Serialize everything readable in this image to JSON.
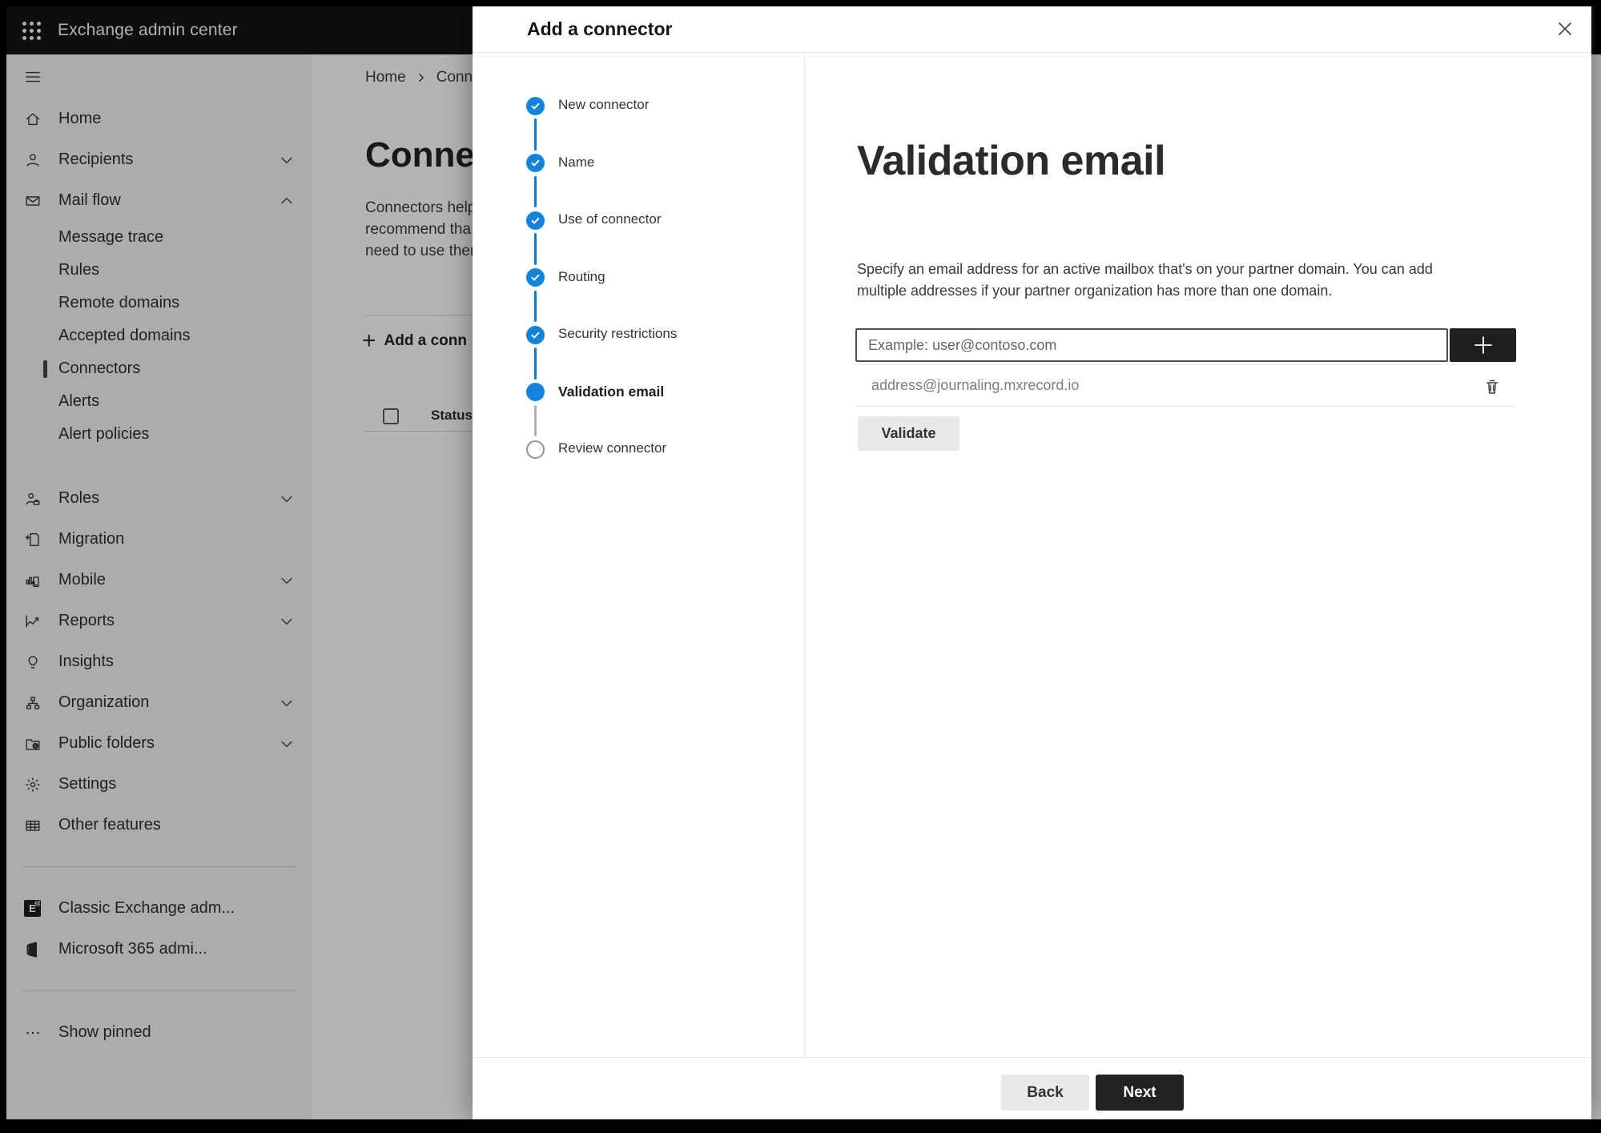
{
  "app_bar": {
    "title": "Exchange admin center"
  },
  "sidebar": {
    "items": [
      {
        "label": "Home",
        "icon": "home-icon",
        "type": "main"
      },
      {
        "label": "Recipients",
        "icon": "person-icon",
        "type": "main",
        "chevron": "down"
      },
      {
        "label": "Mail flow",
        "icon": "mail-icon",
        "type": "main",
        "chevron": "up"
      },
      {
        "label": "Message trace",
        "type": "sub"
      },
      {
        "label": "Rules",
        "type": "sub"
      },
      {
        "label": "Remote domains",
        "type": "sub"
      },
      {
        "label": "Accepted domains",
        "type": "sub"
      },
      {
        "label": "Connectors",
        "type": "sub",
        "selected": true
      },
      {
        "label": "Alerts",
        "type": "sub"
      },
      {
        "label": "Alert policies",
        "type": "sub",
        "last_sub": true
      },
      {
        "label": "Roles",
        "icon": "roles-icon",
        "type": "main",
        "chevron": "down"
      },
      {
        "label": "Migration",
        "icon": "migration-icon",
        "type": "main"
      },
      {
        "label": "Mobile",
        "icon": "mobile-icon",
        "type": "main",
        "chevron": "down"
      },
      {
        "label": "Reports",
        "icon": "reports-icon",
        "type": "main",
        "chevron": "down"
      },
      {
        "label": "Insights",
        "icon": "insights-icon",
        "type": "main"
      },
      {
        "label": "Organization",
        "icon": "organization-icon",
        "type": "main",
        "chevron": "down"
      },
      {
        "label": "Public folders",
        "icon": "public-folders-icon",
        "type": "main",
        "chevron": "down"
      },
      {
        "label": "Settings",
        "icon": "settings-icon",
        "type": "main"
      },
      {
        "label": "Other features",
        "icon": "other-features-icon",
        "type": "main"
      },
      {
        "type": "divider"
      },
      {
        "label": "Classic Exchange adm...",
        "icon": "classic-exchange-icon",
        "type": "main"
      },
      {
        "label": "Microsoft 365 admi...",
        "icon": "microsoft-365-icon",
        "type": "main"
      },
      {
        "type": "divider"
      },
      {
        "label": "Show pinned",
        "icon": "ellipsis-icon",
        "type": "main"
      }
    ]
  },
  "page": {
    "breadcrumb": [
      "Home",
      "Conne"
    ],
    "title": "Connect",
    "intro_lines": [
      "Connectors help",
      "recommend tha",
      "need to use ther"
    ],
    "add_button_label": "Add a conn",
    "table_first_column_header": "Status"
  },
  "dialog": {
    "title": "Add a connector",
    "steps": [
      {
        "label": "New connector",
        "state": "complete"
      },
      {
        "label": "Name",
        "state": "complete"
      },
      {
        "label": "Use of connector",
        "state": "complete"
      },
      {
        "label": "Routing",
        "state": "complete"
      },
      {
        "label": "Security restrictions",
        "state": "complete"
      },
      {
        "label": "Validation email",
        "state": "current"
      },
      {
        "label": "Review connector",
        "state": "upcoming"
      }
    ],
    "heading": "Validation email",
    "description_lines": [
      "Specify an email address for an active mailbox that's on your partner domain. You can add",
      "multiple addresses if your partner organization has more than one domain."
    ],
    "email_input_placeholder": "Example: user@contoso.com",
    "addresses": [
      "address@journaling.mxrecord.io"
    ],
    "validate_button": "Validate",
    "back_button": "Back",
    "next_button": "Next"
  },
  "colors": {
    "accent_blue": "#1583db",
    "step_line_blue": "#1079d8",
    "dark_button": "#1f1f1f",
    "upcoming_gray": "#949494"
  }
}
